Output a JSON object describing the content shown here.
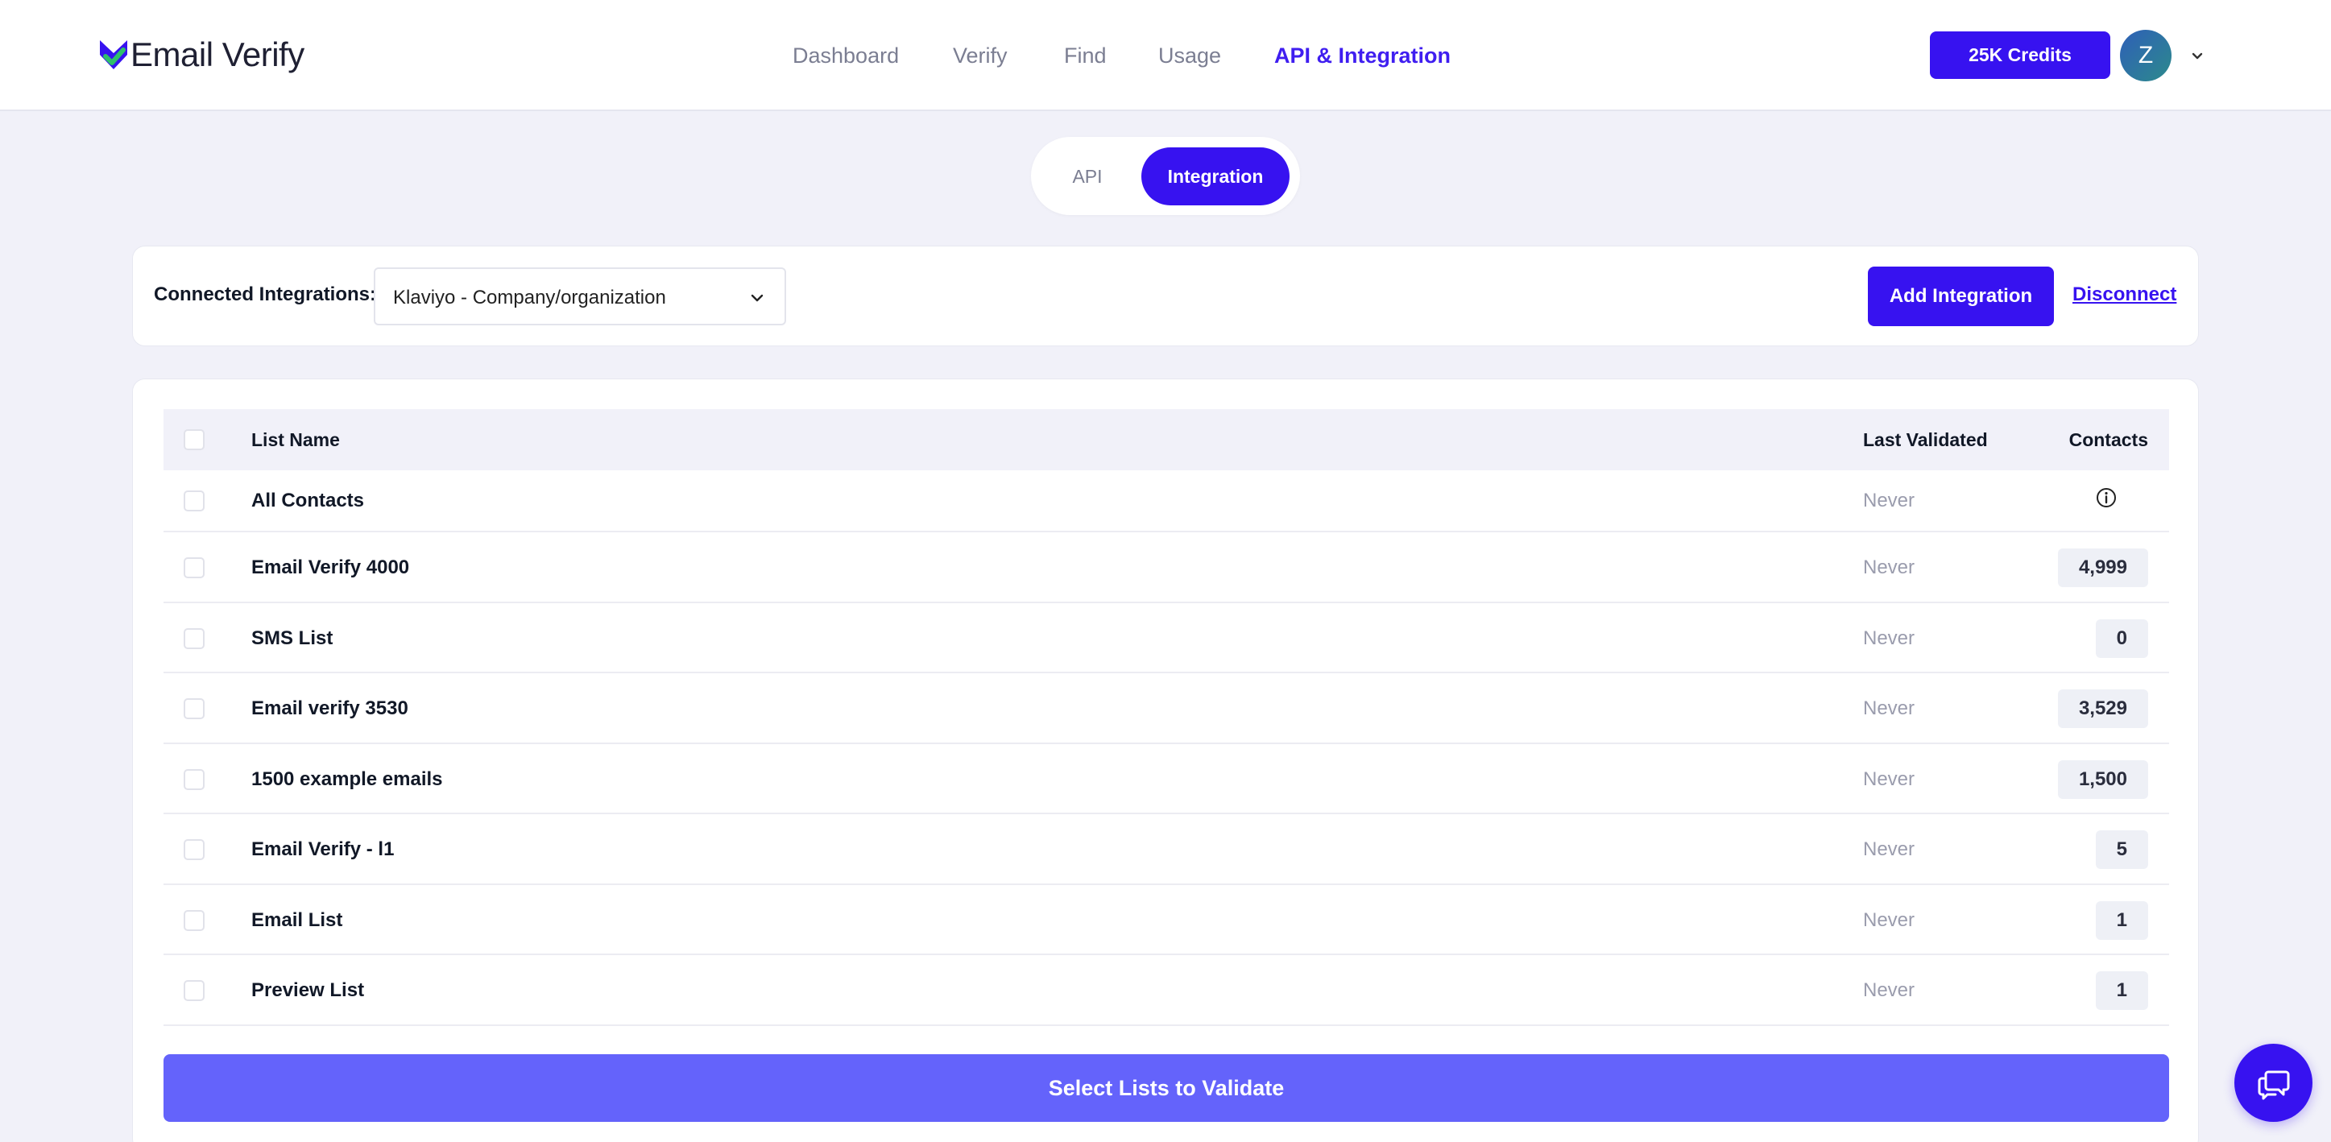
{
  "brand": {
    "name": "Email Verify",
    "accent": "#3712f0",
    "logo_green": "#2fc06b"
  },
  "nav": {
    "items": [
      {
        "label": "Dashboard",
        "active": false
      },
      {
        "label": "Verify",
        "active": false
      },
      {
        "label": "Find",
        "active": false
      },
      {
        "label": "Usage",
        "active": false
      },
      {
        "label": "API & Integration",
        "active": true
      }
    ]
  },
  "header": {
    "credits_label": "25K Credits",
    "avatar_initial": "Z"
  },
  "tabs": {
    "api_label": "API",
    "integration_label": "Integration",
    "selected": "Integration"
  },
  "integrations": {
    "label": "Connected Integrations:",
    "selected": "Klaviyo - Company/organization",
    "add_label": "Add Integration",
    "disconnect_label": "Disconnect"
  },
  "table": {
    "headers": {
      "name": "List Name",
      "last_validated": "Last Validated",
      "contacts": "Contacts"
    },
    "rows": [
      {
        "name": "All Contacts",
        "last_validated": "Never",
        "contacts": null,
        "contacts_icon": "info-icon"
      },
      {
        "name": "Email Verify 4000",
        "last_validated": "Never",
        "contacts": "4,999"
      },
      {
        "name": "SMS List",
        "last_validated": "Never",
        "contacts": "0"
      },
      {
        "name": "Email verify 3530",
        "last_validated": "Never",
        "contacts": "3,529"
      },
      {
        "name": "1500 example emails",
        "last_validated": "Never",
        "contacts": "1,500"
      },
      {
        "name": "Email Verify - l1",
        "last_validated": "Never",
        "contacts": "5"
      },
      {
        "name": "Email List",
        "last_validated": "Never",
        "contacts": "1"
      },
      {
        "name": "Preview List",
        "last_validated": "Never",
        "contacts": "1"
      }
    ]
  },
  "validate_label": "Select Lists to Validate",
  "chat": {
    "icon": "chat-bubble-icon"
  }
}
